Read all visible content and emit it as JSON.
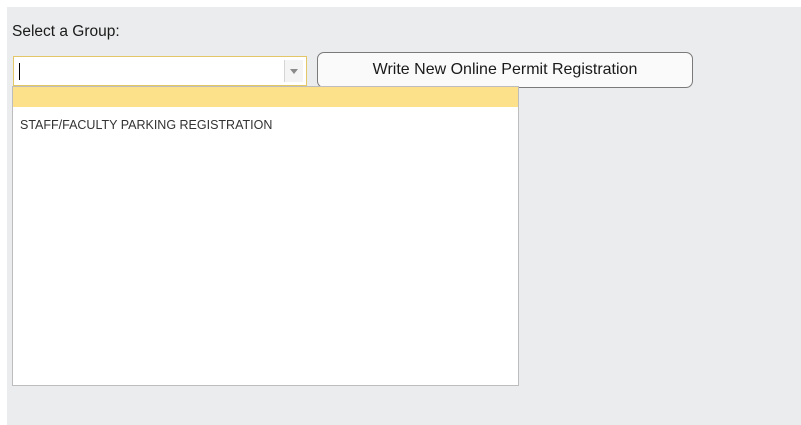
{
  "form": {
    "label": "Select a Group:",
    "combo": {
      "value": "",
      "arrow_icon": "chevron-down-icon"
    },
    "write_button_label": "Write New Online Permit Registration"
  },
  "dropdown": {
    "items": [
      {
        "label": "",
        "highlighted": true
      },
      {
        "label": "STAFF/FACULTY PARKING REGISTRATION",
        "highlighted": false
      }
    ]
  },
  "colors": {
    "panel_background": "#ebeced",
    "highlight": "#fde18a",
    "combo_border": "#e3c766"
  }
}
